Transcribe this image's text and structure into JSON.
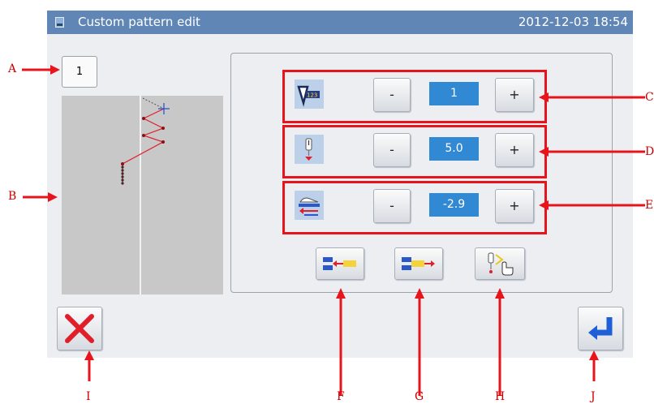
{
  "titlebar": {
    "title": "Custom pattern edit",
    "datetime": "2012-12-03  18:54"
  },
  "pattern_number": "1",
  "rows": [
    {
      "icon": "stitch-count-icon",
      "minus": "-",
      "value": "1",
      "plus": "+"
    },
    {
      "icon": "needle-length-icon",
      "minus": "-",
      "value": "5.0",
      "plus": "+"
    },
    {
      "icon": "feed-offset-icon",
      "minus": "-",
      "value": "-2.9",
      "plus": "+"
    }
  ],
  "bottom_buttons": [
    "shift-left-icon",
    "shift-right-icon",
    "needle-touch-icon"
  ],
  "callouts": {
    "A": "A",
    "B": "B",
    "C": "C",
    "D": "D",
    "E": "E",
    "F": "F",
    "G": "G",
    "H": "H",
    "I": "I",
    "J": "J"
  },
  "colors": {
    "titlebar": "#5f86b5",
    "value_box": "#3289d3",
    "callout": "#e8141c"
  }
}
